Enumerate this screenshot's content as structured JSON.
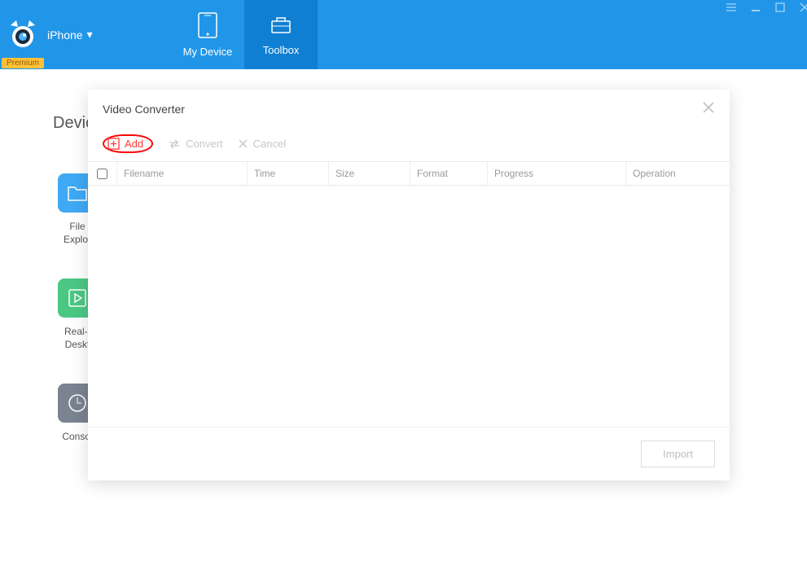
{
  "header": {
    "device_label": "iPhone",
    "premium": "Premium",
    "tabs": [
      {
        "label": "My Device"
      },
      {
        "label": "Toolbox"
      }
    ]
  },
  "main": {
    "section_title": "Devic",
    "tools": [
      {
        "label": "File\nExplor"
      },
      {
        "label": "Real-t\nDeskt"
      },
      {
        "label": "Consol"
      }
    ]
  },
  "modal": {
    "title": "Video Converter",
    "toolbar": {
      "add": "Add",
      "convert": "Convert",
      "cancel": "Cancel"
    },
    "columns": {
      "filename": "Filename",
      "time": "Time",
      "size": "Size",
      "format": "Format",
      "progress": "Progress",
      "operation": "Operation"
    },
    "import_button": "Import"
  }
}
